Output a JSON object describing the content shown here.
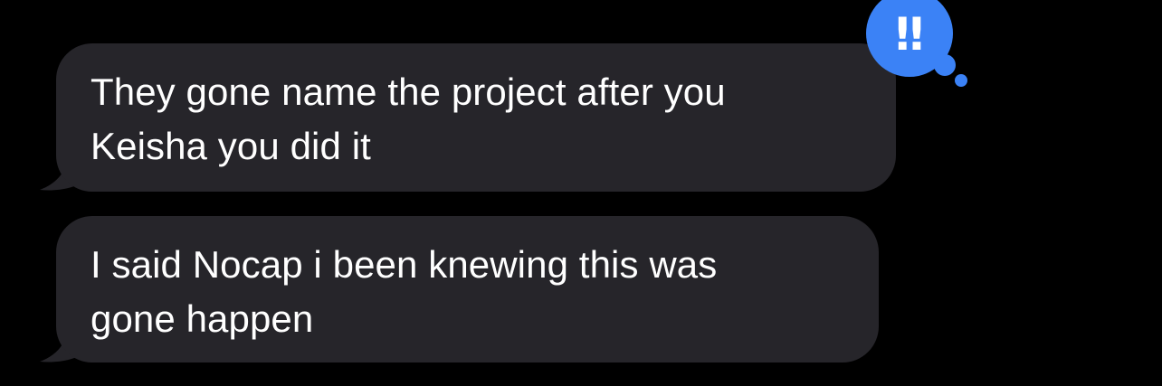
{
  "conversation": {
    "messages": [
      {
        "text": "They gone name the project after you\nKeisha you did it",
        "direction": "received",
        "tapback": {
          "icon": "double-exclamation-icon",
          "glyph": "‼",
          "color": "#3b82f6"
        }
      },
      {
        "text": "I said Nocap i been knewing this was\ngone happen",
        "direction": "received"
      }
    ],
    "colors": {
      "background": "#000000",
      "received_bubble": "#26252a",
      "text": "#ffffff",
      "tapback": "#3b82f6"
    }
  }
}
